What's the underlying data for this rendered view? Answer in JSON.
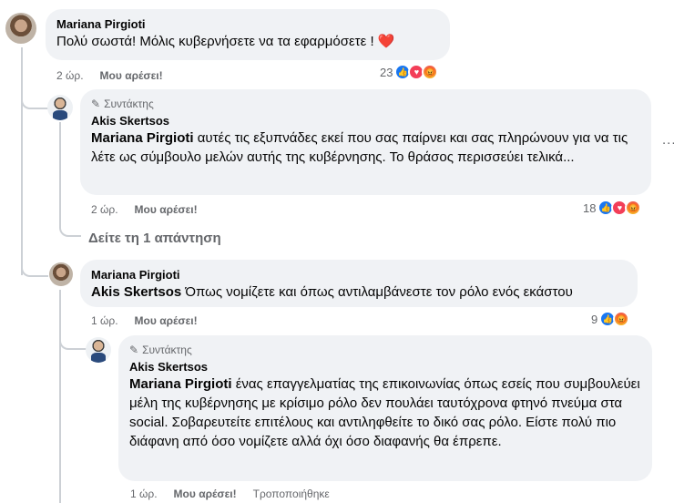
{
  "comments": [
    {
      "author": "Mariana Pirgioti",
      "text": "Πολύ σωστά! Μόλις κυβερνήσετε να τα εφαρμόσετε !",
      "emoji": "❤️",
      "time": "2 ώρ.",
      "like_label": "Μου αρέσει!",
      "reaction_count": "23",
      "reactions": [
        "like-icon",
        "love-icon",
        "angry-icon"
      ]
    },
    {
      "badge": "Συντάκτης",
      "author": "Akis Skertsos",
      "mention": "Mariana Pirgioti",
      "text": "αυτές τις εξυπνάδες εκεί που σας παίρνει και σας πληρώνουν για να τις λέτε ως σύμβουλο μελών αυτής της κυβέρνησης. Το θράσος περισσεύει τελικά...",
      "time": "2 ώρ.",
      "like_label": "Μου αρέσει!",
      "reaction_count": "18",
      "reactions": [
        "like-icon",
        "love-icon",
        "angry-icon"
      ],
      "more": "..."
    },
    {
      "author": "Mariana Pirgioti",
      "mention": "Akis Skertsos",
      "text": "Όπως νομίζετε και όπως αντιλαμβάνεστε τον ρόλο ενός εκάστου",
      "time": "1 ώρ.",
      "like_label": "Μου αρέσει!",
      "reaction_count": "9",
      "reactions": [
        "like-icon",
        "angry-icon"
      ]
    },
    {
      "badge": "Συντάκτης",
      "author": "Akis Skertsos",
      "mention": "Mariana Pirgioti",
      "text": "ένας επαγγελματίας της επικοινωνίας όπως εσείς που συμβουλεύει μέλη της κυβέρνησης με κρίσιμο ρόλο δεν πουλάει ταυτόχρονα φτηνό πνεύμα στα social. Σοβαρευτείτε επιτέλους και αντιληφθείτε το δικό σας ρόλο. Είστε πολύ πιο διάφανη από όσο νομίζετε αλλά όχι όσο διαφανής θα έπρεπε.",
      "time": "1 ώρ.",
      "like_label": "Μου αρέσει!",
      "edited": "Τροποποιήθηκε"
    }
  ],
  "view_replies": "Δείτε τη 1 απάντηση"
}
